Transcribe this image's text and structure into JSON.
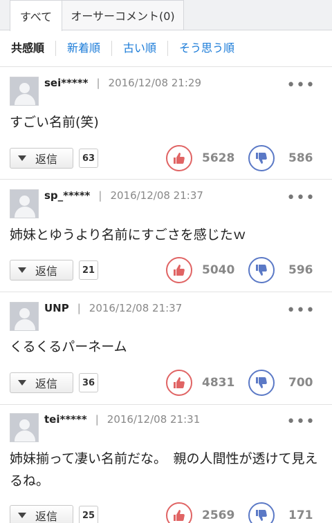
{
  "tabs": [
    {
      "label": "すべて",
      "active": true
    },
    {
      "label": "オーサーコメント(0)",
      "active": false
    }
  ],
  "sort": [
    "共感順",
    "新着順",
    "古い順",
    "そう思う順"
  ],
  "colors": {
    "link": "#1a7bd8",
    "like": "#e06464",
    "dislike": "#5b79c6"
  },
  "reply_label": "返信",
  "comments": [
    {
      "author": "sei*****",
      "time": "2016/12/08 21:29",
      "text": "すごい名前(笑)",
      "replies": "63",
      "likes": "5628",
      "dislikes": "586"
    },
    {
      "author": "sp_*****",
      "time": "2016/12/08 21:37",
      "text": "姉妹とゆうより名前にすごさを感じたｗ",
      "replies": "21",
      "likes": "5040",
      "dislikes": "596"
    },
    {
      "author": "UNP",
      "time": "2016/12/08 21:37",
      "text": "くるくるパーネーム",
      "replies": "36",
      "likes": "4831",
      "dislikes": "700"
    },
    {
      "author": "tei*****",
      "time": "2016/12/08 21:31",
      "text": "姉妹揃って凄い名前だな。　親の人間性が透けて見えるね。",
      "replies": "25",
      "likes": "2569",
      "dislikes": "171"
    }
  ]
}
